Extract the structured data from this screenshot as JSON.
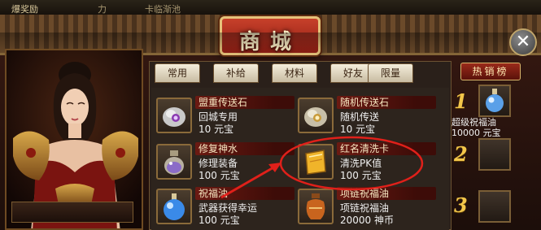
{
  "top_bar": {
    "left_text": "爆奖励",
    "mid_text": "力",
    "right_text": "卡临渐池"
  },
  "title": "商城",
  "tabs": [
    {
      "label": "常用",
      "active": false
    },
    {
      "label": "补给",
      "active": false
    },
    {
      "label": "材料",
      "active": false
    },
    {
      "label": "好友",
      "active": false
    },
    {
      "label": "限量",
      "active": false
    }
  ],
  "items": [
    {
      "name": "盟重传送石",
      "desc": "回城专用",
      "price": "10  元宝",
      "icon": "stone-icon"
    },
    {
      "name": "随机传送石",
      "desc": "随机传送",
      "price": "10  元宝",
      "icon": "stone-icon"
    },
    {
      "name": "修复神水",
      "desc": "修理装备",
      "price": "100  元宝",
      "icon": "potion-icon"
    },
    {
      "name": "红名清洗卡",
      "desc": "清洗PK值",
      "price": "100  元宝",
      "icon": "card-icon"
    },
    {
      "name": "祝福油",
      "desc": "武器获得幸运",
      "price": "100  元宝",
      "icon": "oil-icon"
    },
    {
      "name": "项链祝福油",
      "desc": "项链祝福油",
      "price": "20000  神币",
      "icon": "urn-icon"
    }
  ],
  "hot_list": {
    "title": "热销榜",
    "ranks": [
      "1",
      "2",
      "3"
    ],
    "top_item_name": "超级祝福油",
    "top_item_price": "10000  元宝"
  },
  "colors": {
    "accent_red": "#c7402a",
    "gold": "#e6c27a",
    "annotation_red": "#e0201a"
  }
}
